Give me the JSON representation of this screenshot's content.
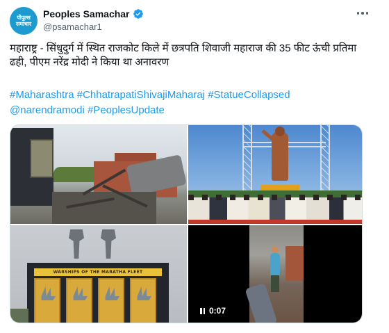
{
  "author": {
    "avatar_line1": "पीपुल्स",
    "avatar_line2": "समाचार",
    "display_name": "Peoples Samachar",
    "handle": "@psamachar1",
    "verified": true
  },
  "tweet": {
    "text": "महाराष्ट्र - सिंधुदुर्ग में स्थित राजकोट किले में छत्रपति शिवाजी महाराज की 35 फीट ऊंची प्रतिमा ढही, पीएम नरेंद्र मोदी ने किया था अनावरण",
    "hashtags": [
      "#Maharashtra",
      "#ChhatrapatiShivajiMaharaj",
      "#StatueCollapsed",
      "@narendramodi",
      "#PeoplesUpdate"
    ]
  },
  "media": {
    "board_title": "WARSHIPS OF THE MARATHA FLEET",
    "video_duration": "0:07"
  },
  "colors": {
    "link": "#1d9bf0",
    "verified": "#1d9bf0",
    "text": "#0f1419",
    "secondary": "#536471"
  },
  "icons": [
    "verified-badge-icon",
    "more-options-icon",
    "pause-icon"
  ]
}
